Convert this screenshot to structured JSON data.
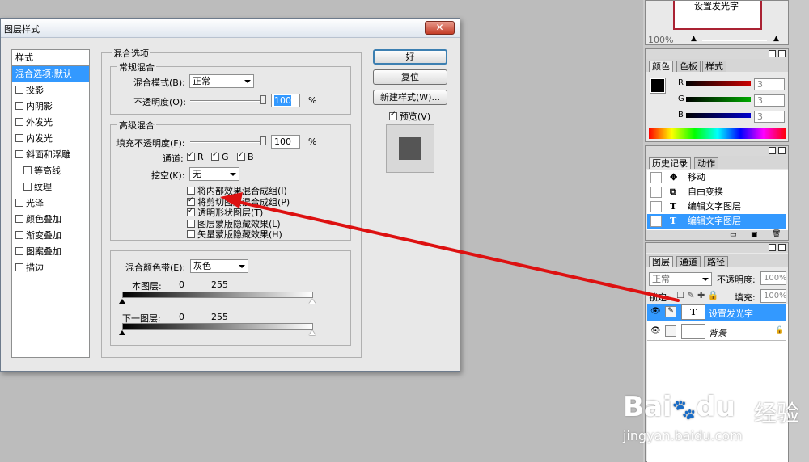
{
  "dialog": {
    "title": "图层样式",
    "close": "✕",
    "sidebar": [
      {
        "label": "样式",
        "type": "header"
      },
      {
        "label": "混合选项:默认",
        "type": "selected"
      },
      {
        "label": "投影",
        "checked": false
      },
      {
        "label": "内阴影",
        "checked": false
      },
      {
        "label": "外发光",
        "checked": false
      },
      {
        "label": "内发光",
        "checked": false
      },
      {
        "label": "斜面和浮雕",
        "checked": false
      },
      {
        "label": "等高线",
        "checked": false,
        "indent": true
      },
      {
        "label": "纹理",
        "checked": false,
        "indent": true
      },
      {
        "label": "光泽",
        "checked": false
      },
      {
        "label": "颜色叠加",
        "checked": false
      },
      {
        "label": "渐变叠加",
        "checked": false
      },
      {
        "label": "图案叠加",
        "checked": false
      },
      {
        "label": "描边",
        "checked": false
      }
    ],
    "blend_options": {
      "title": "混合选项",
      "general": {
        "title": "常规混合",
        "mode_label": "混合模式(B):",
        "mode_value": "正常",
        "opacity_label": "不透明度(O):",
        "opacity_value": "100",
        "unit": "%"
      },
      "advanced": {
        "title": "高级混合",
        "fill_label": "填充不透明度(F):",
        "fill_value": "100",
        "unit": "%",
        "channel_label": "通道:",
        "channels": [
          "R",
          "G",
          "B"
        ],
        "knockout_label": "挖空(K):",
        "knockout_value": "无",
        "options": [
          {
            "label": "将内部效果混合成组(I)",
            "checked": false
          },
          {
            "label": "将剪切图层混合成组(P)",
            "checked": true
          },
          {
            "label": "透明形状图层(T)",
            "checked": true
          },
          {
            "label": "图层蒙版隐藏效果(L)",
            "checked": false
          },
          {
            "label": "矢量蒙版隐藏效果(H)",
            "checked": false
          }
        ]
      },
      "blend_if": {
        "label": "混合颜色带(E):",
        "value": "灰色",
        "this_layer": "本图层:",
        "under_layer": "下一图层:",
        "min": "0",
        "max": "255"
      }
    },
    "buttons": {
      "ok": "好",
      "reset": "复位",
      "new_style": "新建样式(W)...",
      "preview": "预览(V)"
    }
  },
  "navigator": {
    "preview_text": "设置发光字",
    "zoom": "100%"
  },
  "color_panel": {
    "tabs": [
      "颜色",
      "色板",
      "样式"
    ],
    "channels": [
      {
        "name": "R",
        "value": "3",
        "color": "#cc0000"
      },
      {
        "name": "G",
        "value": "3",
        "color": "#00aa00"
      },
      {
        "name": "B",
        "value": "3",
        "color": "#0000cc"
      }
    ]
  },
  "history_panel": {
    "tabs": [
      "历史记录",
      "动作"
    ],
    "items": [
      {
        "label": "移动",
        "icon": "move-icon"
      },
      {
        "label": "自由变换",
        "icon": "transform-icon"
      },
      {
        "label": "编辑文字图层",
        "icon": "text-layer-icon"
      },
      {
        "label": "编辑文字图层",
        "icon": "text-layer-icon",
        "selected": true
      }
    ]
  },
  "layers_panel": {
    "tabs": [
      "图层",
      "通道",
      "路径"
    ],
    "blend_mode": "正常",
    "opacity_label": "不透明度:",
    "opacity_value": "100%",
    "lock_label": "锁定:",
    "fill_label": "填充:",
    "fill_value": "100%",
    "layers": [
      {
        "name": "设置发光字",
        "type": "text",
        "selected": true
      },
      {
        "name": "背景",
        "type": "background",
        "locked": true
      }
    ]
  },
  "watermark": {
    "brand": "Bai",
    "brand2": "du",
    "cn": "经验",
    "url": "jingyan.baidu.com"
  },
  "colors": {
    "accent": "#3399ff",
    "arrow": "#dd1111"
  }
}
